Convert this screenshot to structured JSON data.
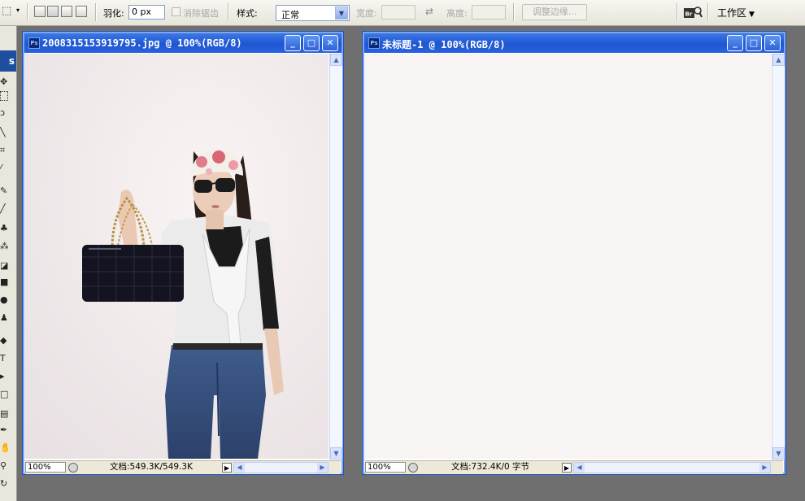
{
  "options_bar": {
    "feather_label": "羽化:",
    "feather_value": "0 px",
    "antialias_label": "消除锯齿",
    "style_label": "样式:",
    "style_value": "正常",
    "width_label": "宽度:",
    "height_label": "高度:",
    "refine_edge_label": "调整边缘...",
    "bridge_label": "Br",
    "workspace_label": "工作区"
  },
  "toolbox": {
    "logo": "s"
  },
  "windows": [
    {
      "title": "2008315153919795.jpg @ 100%(RGB/8)",
      "zoom": "100%",
      "doc_info": "文档:549.3K/549.3K"
    },
    {
      "title": "未标题-1 @ 100%(RGB/8)",
      "zoom": "100%",
      "doc_info": "文档:732.4K/0 字节",
      "canvas_color": "#f8f4f3"
    }
  ],
  "colors": {
    "titlebar": "#1f55d2",
    "workspace_bg": "#6f6f6f",
    "toolbox_logo": "#1d4f9e"
  }
}
